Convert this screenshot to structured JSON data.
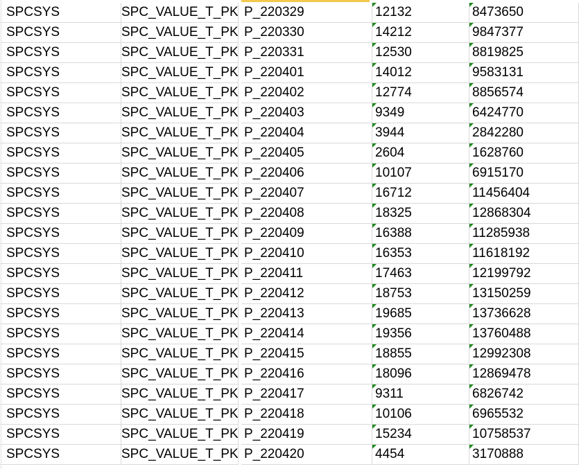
{
  "sheet": {
    "rows": [
      {
        "owner": "SPCSYS",
        "table": "SPC_VALUE_T_PK",
        "partition": "P_220329",
        "num_rows": "12132",
        "bytes": "8473650"
      },
      {
        "owner": "SPCSYS",
        "table": "SPC_VALUE_T_PK",
        "partition": "P_220330",
        "num_rows": "14212",
        "bytes": "9847377"
      },
      {
        "owner": "SPCSYS",
        "table": "SPC_VALUE_T_PK",
        "partition": "P_220331",
        "num_rows": "12530",
        "bytes": "8819825"
      },
      {
        "owner": "SPCSYS",
        "table": "SPC_VALUE_T_PK",
        "partition": "P_220401",
        "num_rows": "14012",
        "bytes": "9583131"
      },
      {
        "owner": "SPCSYS",
        "table": "SPC_VALUE_T_PK",
        "partition": "P_220402",
        "num_rows": "12774",
        "bytes": "8856574"
      },
      {
        "owner": "SPCSYS",
        "table": "SPC_VALUE_T_PK",
        "partition": "P_220403",
        "num_rows": "9349",
        "bytes": "6424770"
      },
      {
        "owner": "SPCSYS",
        "table": "SPC_VALUE_T_PK",
        "partition": "P_220404",
        "num_rows": "3944",
        "bytes": "2842280"
      },
      {
        "owner": "SPCSYS",
        "table": "SPC_VALUE_T_PK",
        "partition": "P_220405",
        "num_rows": "2604",
        "bytes": "1628760"
      },
      {
        "owner": "SPCSYS",
        "table": "SPC_VALUE_T_PK",
        "partition": "P_220406",
        "num_rows": "10107",
        "bytes": "6915170"
      },
      {
        "owner": "SPCSYS",
        "table": "SPC_VALUE_T_PK",
        "partition": "P_220407",
        "num_rows": "16712",
        "bytes": "11456404"
      },
      {
        "owner": "SPCSYS",
        "table": "SPC_VALUE_T_PK",
        "partition": "P_220408",
        "num_rows": "18325",
        "bytes": "12868304"
      },
      {
        "owner": "SPCSYS",
        "table": "SPC_VALUE_T_PK",
        "partition": "P_220409",
        "num_rows": "16388",
        "bytes": "11285938"
      },
      {
        "owner": "SPCSYS",
        "table": "SPC_VALUE_T_PK",
        "partition": "P_220410",
        "num_rows": "16353",
        "bytes": "11618192"
      },
      {
        "owner": "SPCSYS",
        "table": "SPC_VALUE_T_PK",
        "partition": "P_220411",
        "num_rows": "17463",
        "bytes": "12199792"
      },
      {
        "owner": "SPCSYS",
        "table": "SPC_VALUE_T_PK",
        "partition": "P_220412",
        "num_rows": "18753",
        "bytes": "13150259"
      },
      {
        "owner": "SPCSYS",
        "table": "SPC_VALUE_T_PK",
        "partition": "P_220413",
        "num_rows": "19685",
        "bytes": "13736628"
      },
      {
        "owner": "SPCSYS",
        "table": "SPC_VALUE_T_PK",
        "partition": "P_220414",
        "num_rows": "19356",
        "bytes": "13760488"
      },
      {
        "owner": "SPCSYS",
        "table": "SPC_VALUE_T_PK",
        "partition": "P_220415",
        "num_rows": "18855",
        "bytes": "12992308"
      },
      {
        "owner": "SPCSYS",
        "table": "SPC_VALUE_T_PK",
        "partition": "P_220416",
        "num_rows": "18096",
        "bytes": "12869478"
      },
      {
        "owner": "SPCSYS",
        "table": "SPC_VALUE_T_PK",
        "partition": "P_220417",
        "num_rows": "9311",
        "bytes": "6826742"
      },
      {
        "owner": "SPCSYS",
        "table": "SPC_VALUE_T_PK",
        "partition": "P_220418",
        "num_rows": "10106",
        "bytes": "6965532"
      },
      {
        "owner": "SPCSYS",
        "table": "SPC_VALUE_T_PK",
        "partition": "P_220419",
        "num_rows": "15234",
        "bytes": "10758537"
      },
      {
        "owner": "SPCSYS",
        "table": "SPC_VALUE_T_PK",
        "partition": "P_220420",
        "num_rows": "4454",
        "bytes": "3170888"
      }
    ]
  },
  "colors": {
    "gridline": "#d9d9d9",
    "number_stored_as_text_marker": "#1d8a1d",
    "selected_column_header": "#f2c94c"
  }
}
